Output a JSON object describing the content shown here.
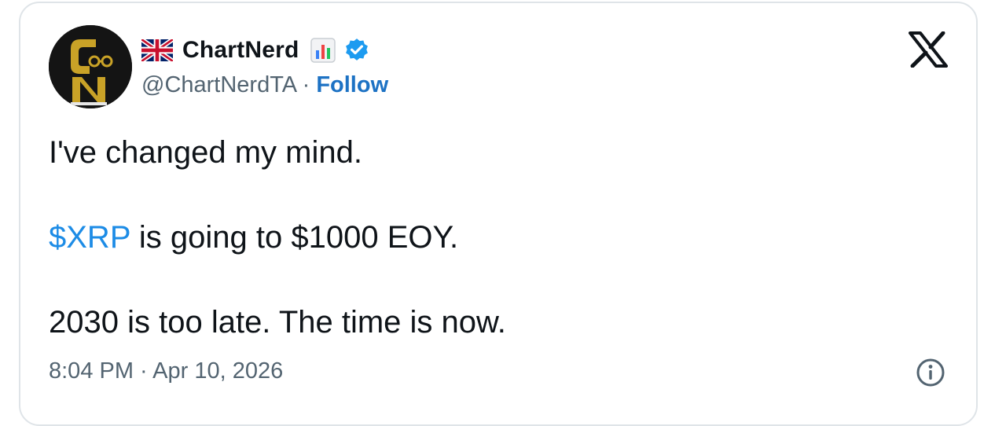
{
  "author": {
    "display_name": "ChartNerd",
    "handle": "@ChartNerdTA",
    "separator": "·",
    "follow_label": "Follow",
    "flag_icon": "uk-flag-icon",
    "name_emoji_icon": "bar-chart-emoji-icon",
    "verified_icon": "verified-badge-icon",
    "avatar_initials": "CN"
  },
  "tweet": {
    "line1": "I've changed my mind.",
    "line2_cashtag": "$XRP",
    "line2_rest": " is going to $1000 EOY.",
    "line3": "2030 is too late. The time is now."
  },
  "meta": {
    "timestamp": "8:04 PM · Apr 10, 2026",
    "platform_icon": "x-logo-icon",
    "info_icon": "info-icon"
  },
  "colors": {
    "text": "#0f1419",
    "secondary": "#536471",
    "link": "#1d8ce6",
    "follow": "#1d72c4",
    "verified": "#1d9bf0",
    "border": "#dfe4e8",
    "avatar_bg": "#141414",
    "avatar_gold": "#c9a227"
  }
}
